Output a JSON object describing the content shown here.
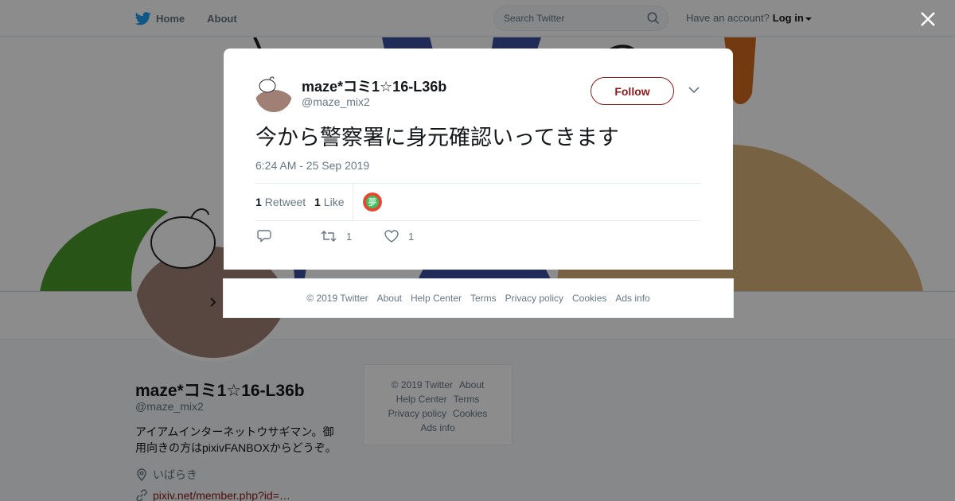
{
  "topnav": {
    "home_label": "Home",
    "about_label": "About",
    "search_placeholder": "Search Twitter",
    "account_prompt": "Have an account?",
    "login_label": "Log in"
  },
  "profile": {
    "name": "maze*コミ1☆16-L36b",
    "handle": "@maze_mix2",
    "bio_line1": "アイアムインターネットウサギマン。御",
    "bio_line2": "用向きの方はpixivFANBOXからどうぞ。",
    "location": "いばらき",
    "url": "pixiv.net/member.php?id=…"
  },
  "side_footer": {
    "copyright": "© 2019 Twitter",
    "about": "About",
    "help": "Help Center",
    "terms": "Terms",
    "privacy": "Privacy policy",
    "cookies": "Cookies",
    "ads": "Ads info"
  },
  "tweet": {
    "author_name": "maze*コミ1☆16-L36b",
    "author_handle": "@maze_mix2",
    "follow_label": "Follow",
    "text": "今から警察署に身元確認いってきます",
    "timestamp": "6:24 AM - 25 Sep 2019",
    "retweet_count": "1",
    "retweet_label": "Retweet",
    "like_count": "1",
    "like_label": "Like",
    "action_retweet_count": "1",
    "action_like_count": "1"
  },
  "modal_footer": {
    "copyright": "© 2019 Twitter",
    "about": "About",
    "help": "Help Center",
    "terms": "Terms",
    "privacy": "Privacy policy",
    "cookies": "Cookies",
    "ads": "Ads info"
  },
  "colors": {
    "twitter_blue": "#1da1f2",
    "follow_accent": "#8b1a1a",
    "overlay": "rgba(0,0,0,0.45)"
  },
  "icons": [
    "twitter-bird-icon",
    "search-icon",
    "close-icon",
    "chevron-down-icon",
    "reply-icon",
    "retweet-icon",
    "heart-icon",
    "location-icon",
    "link-icon"
  ]
}
